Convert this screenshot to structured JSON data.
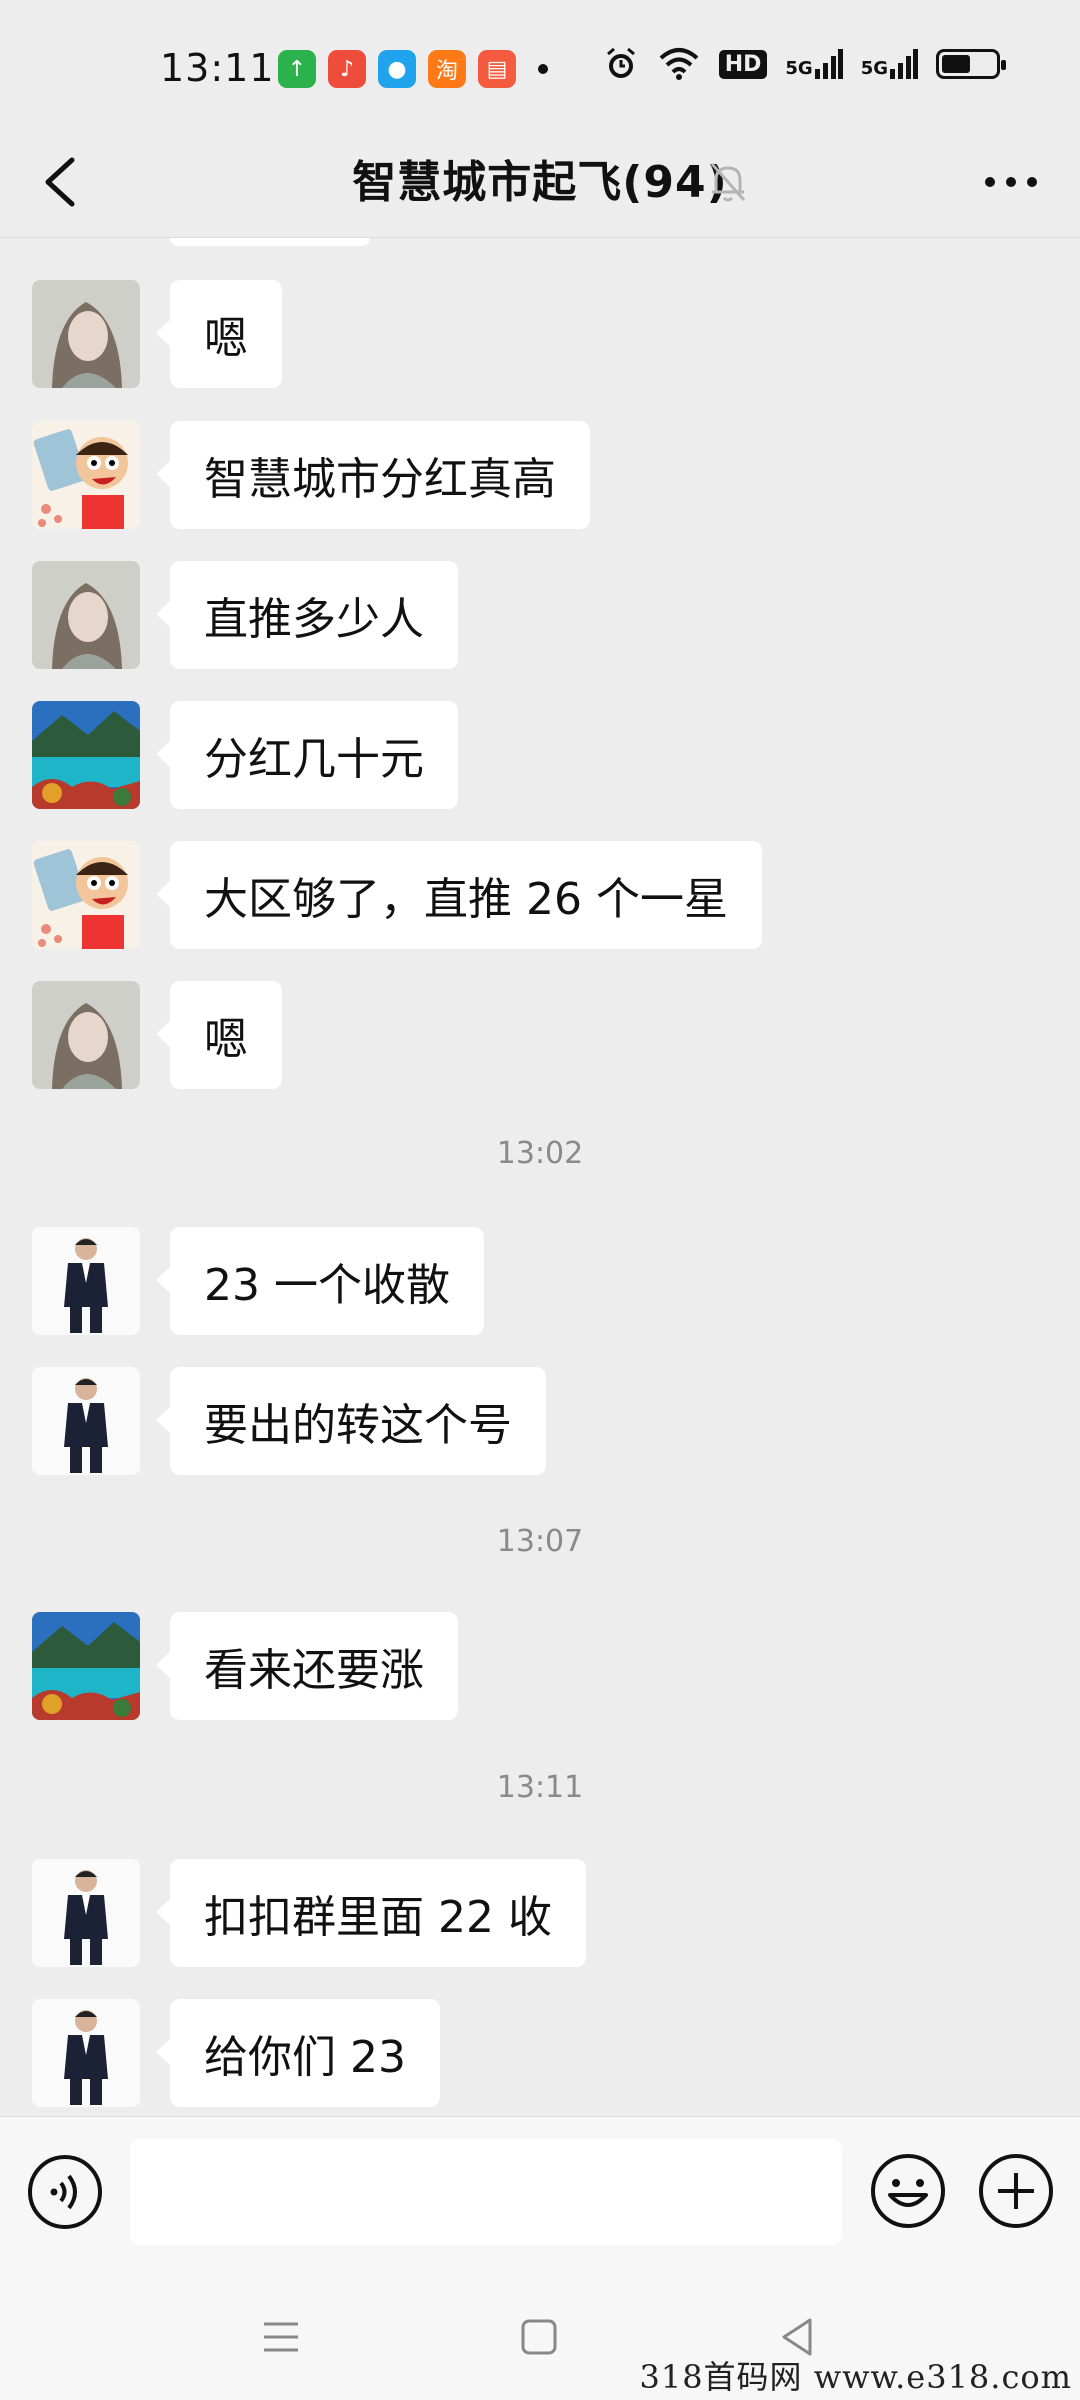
{
  "status": {
    "time": "13:11",
    "apps": [
      {
        "name": "upload-app-icon",
        "color": "#2bb24c",
        "glyph": "↑"
      },
      {
        "name": "music-app-icon",
        "color": "#ef4d3c",
        "glyph": "♪"
      },
      {
        "name": "qq-app-icon",
        "color": "#1fa3ec",
        "glyph": "●"
      },
      {
        "name": "taobao-app-icon",
        "color": "#ff7a16",
        "glyph": "淘"
      },
      {
        "name": "reader-app-icon",
        "color": "#f45b3f",
        "glyph": "▤"
      }
    ],
    "network_label_1": "5G",
    "network_label_2": "5G",
    "hd_label": "HD"
  },
  "header": {
    "title": "智慧城市起飞(94)"
  },
  "messages": [
    {
      "avatar": "girl",
      "text": "嗯"
    },
    {
      "avatar": "cartoon",
      "text": "智慧城市分红真高"
    },
    {
      "avatar": "girl",
      "text": "直推多少人"
    },
    {
      "avatar": "lake",
      "text": "分红几十元"
    },
    {
      "avatar": "cartoon",
      "text": "大区够了，直推 26 个一星"
    },
    {
      "avatar": "girl",
      "text": "嗯"
    },
    {
      "time": "13:02"
    },
    {
      "avatar": "man",
      "text": "23 一个收散"
    },
    {
      "avatar": "man",
      "text": "要出的转这个号"
    },
    {
      "time": "13:07"
    },
    {
      "avatar": "lake",
      "text": "看来还要涨"
    },
    {
      "time": "13:11"
    },
    {
      "avatar": "man",
      "text": "扣扣群里面 22 收"
    },
    {
      "avatar": "man",
      "text": "给你们 23"
    }
  ],
  "input": {
    "value": ""
  },
  "watermark": "318首码网   www.e318.com"
}
